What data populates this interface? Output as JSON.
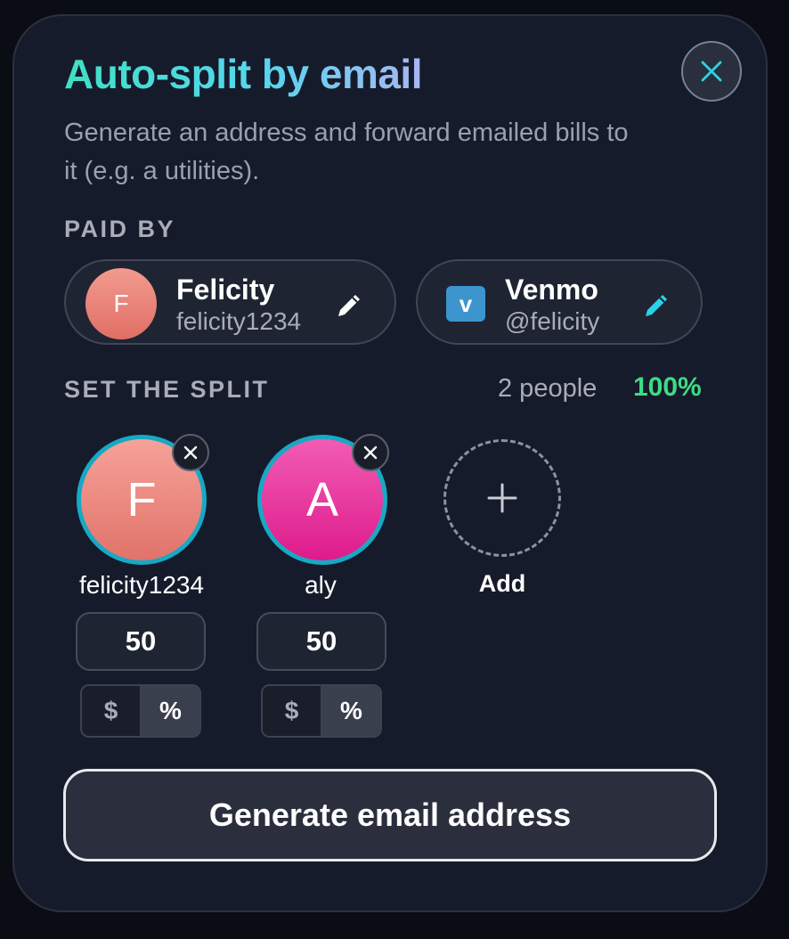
{
  "modal": {
    "title": "Auto-split by email",
    "subtitle": "Generate an address and forward emailed bills to it (e.g. a utilities).",
    "close_icon": "close-icon"
  },
  "paid_by": {
    "label": "PAID BY",
    "payer": {
      "initial": "F",
      "name": "Felicity",
      "handle": "felicity1234",
      "edit_icon": "pencil-icon"
    },
    "payment_method": {
      "icon_letter": "v",
      "name": "Venmo",
      "handle": "@felicity",
      "edit_icon": "pencil-icon"
    }
  },
  "split": {
    "label": "SET THE SPLIT",
    "people_count": "2 people",
    "total_percent": "100%",
    "members": [
      {
        "initial": "F",
        "name": "felicity1234",
        "amount": "50",
        "unit_dollar": "$",
        "unit_percent": "%",
        "selected_unit": "%"
      },
      {
        "initial": "A",
        "name": "aly",
        "amount": "50",
        "unit_dollar": "$",
        "unit_percent": "%",
        "selected_unit": "%"
      }
    ],
    "add_label": "Add"
  },
  "actions": {
    "generate_label": "Generate email address"
  },
  "colors": {
    "background": "#161b2b",
    "accent_cyan": "#2ad4e8",
    "accent_green": "#3ddc84",
    "title_gradient_start": "#3fe0c5",
    "title_gradient_end": "#a9b7f2",
    "venmo_blue": "#3d95ce",
    "avatar_felicity": "#e98378",
    "avatar_aly": "#e8359f"
  }
}
